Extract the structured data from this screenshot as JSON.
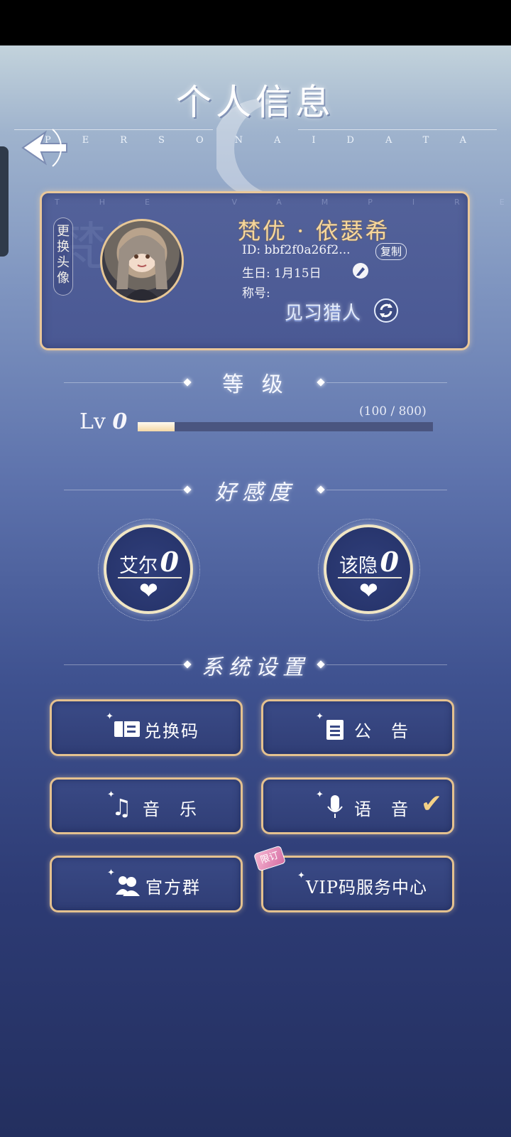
{
  "header": {
    "title": "个人信息",
    "subtitle": "PERSONAIDATA"
  },
  "profile": {
    "card_top_text": "THE VAMPIRE HUNTERS",
    "watermark": "梵优",
    "change_avatar_label": "更换头像",
    "name": "梵优 · 依瑟希",
    "id_label": "ID:",
    "id_value": "bbf2f0a26f2...",
    "copy_label": "复制",
    "birthday_label": "生日:",
    "birthday_value": "1月15日",
    "title_label": "称号:",
    "title_value": "见习猎人"
  },
  "level": {
    "heading": "等 级",
    "lv_prefix": "Lv",
    "lv_value": "0",
    "exp_text": "(100 / 800)",
    "progress": 0.125
  },
  "affinity": {
    "heading": "好感度",
    "characters": [
      {
        "name": "艾尔",
        "value": "0"
      },
      {
        "name": "该隐",
        "value": "0"
      }
    ]
  },
  "settings": {
    "heading": "系统设置",
    "buttons": [
      {
        "label": "兑换码",
        "icon": "ticket-icon"
      },
      {
        "label": "公　告",
        "icon": "notepad-icon"
      },
      {
        "label": "音　乐",
        "icon": "music-note-icon"
      },
      {
        "label": "语　音",
        "icon": "microphone-icon",
        "checked": true
      },
      {
        "label": "官方群",
        "icon": "users-icon"
      },
      {
        "label": "VIP码服务中心",
        "icon": "sparkle-icon"
      }
    ],
    "limited_tag": "限订"
  },
  "colors": {
    "gold_border": "#e4c18f",
    "name_gold": "#f7d79c"
  }
}
